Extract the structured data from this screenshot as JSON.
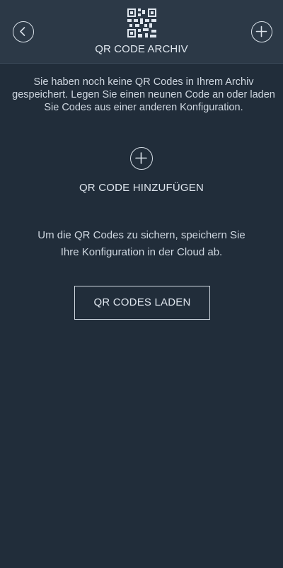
{
  "header": {
    "title": "QR CODE ARCHIV",
    "back_icon": "chevron-left-icon",
    "add_icon": "plus-icon",
    "logo_icon": "qr-code-icon"
  },
  "main": {
    "intro_text": "Sie haben noch keine QR Codes in Ihrem Archiv gespeichert. Legen Sie einen neunen Code an oder laden Sie Codes aus einer anderen Konfiguration.",
    "add_code_label": "QR CODE HINZUFÜGEN",
    "cloud_note_line1": "Um die QR Codes zu sichern, speichern Sie",
    "cloud_note_line2": "Ihre Konfiguration in der Cloud ab.",
    "load_button_label": "QR CODES LADEN"
  },
  "colors": {
    "background": "#212d3a",
    "header_background": "#2c3947",
    "text": "#cfd7e0"
  }
}
